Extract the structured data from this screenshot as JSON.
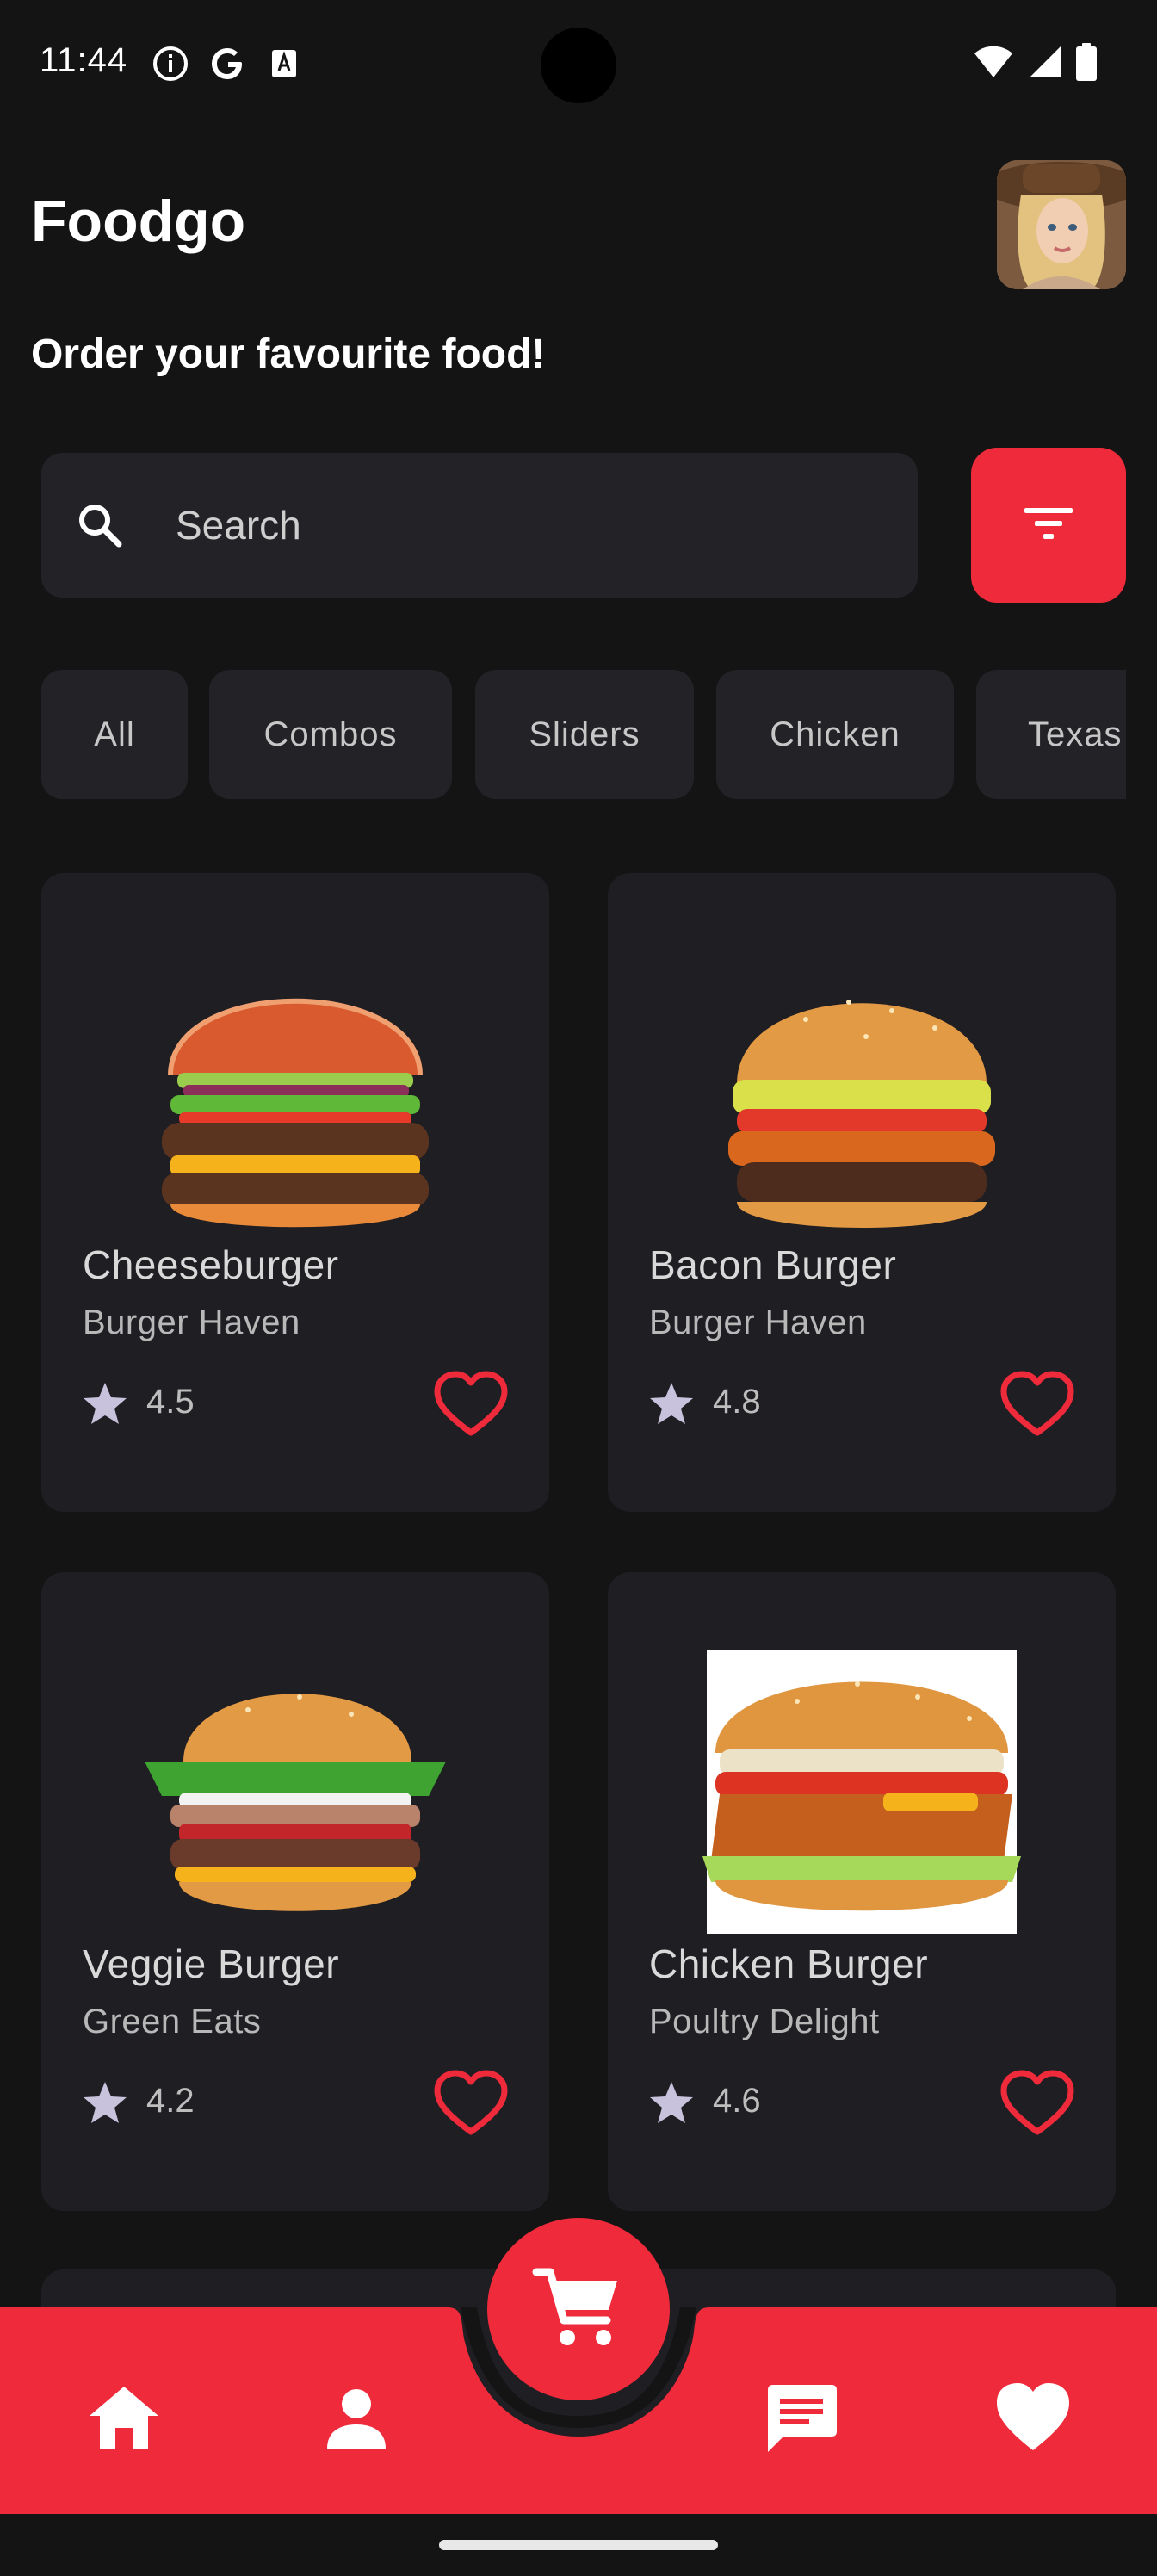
{
  "status_bar": {
    "time": "11:44",
    "left_icons": [
      "info-icon",
      "google-icon",
      "translate-icon"
    ],
    "right_icons": [
      "wifi-icon",
      "signal-icon",
      "battery-icon"
    ]
  },
  "header": {
    "title": "Foodgo",
    "subtitle": "Order your favourite food!",
    "avatar_icon": "user-avatar"
  },
  "search": {
    "placeholder": "Search",
    "value": "",
    "icon": "search-icon",
    "filter_icon": "filter-icon"
  },
  "categories": [
    "All",
    "Combos",
    "Sliders",
    "Chicken",
    "Texas"
  ],
  "products": [
    {
      "name": "Cheeseburger",
      "restaurant": "Burger Haven",
      "rating": "4.5"
    },
    {
      "name": "Bacon Burger",
      "restaurant": "Burger Haven",
      "rating": "4.8"
    },
    {
      "name": "Veggie Burger",
      "restaurant": "Green Eats",
      "rating": "4.2"
    },
    {
      "name": "Chicken Burger",
      "restaurant": "Poultry Delight",
      "rating": "4.6"
    }
  ],
  "bottom_nav": {
    "items": [
      "home-icon",
      "profile-icon",
      "cart-icon",
      "chat-icon",
      "favorites-icon"
    ]
  },
  "colors": {
    "accent": "#ee2a3b",
    "background": "#141414",
    "surface": "#1f1e23",
    "chip": "#232227"
  }
}
